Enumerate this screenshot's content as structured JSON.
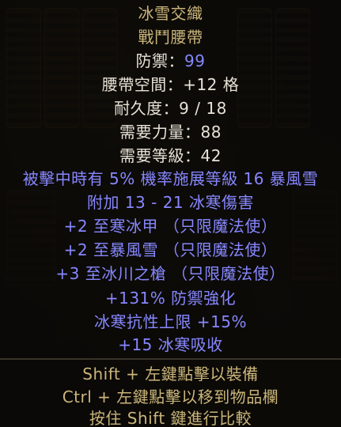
{
  "item": {
    "name": "冰雪交織",
    "type": "戰鬥腰帶",
    "defense_label": "防禦：",
    "defense_value": "99",
    "belt_slots": "腰帶空間：+12 格",
    "durability": "耐久度：9 / 18",
    "req_strength": "需要力量：88",
    "req_level": "需要等級：42"
  },
  "mods": [
    "被擊中時有 5% 機率施展等級 16 暴風雪",
    "附加 13 - 21 冰寒傷害",
    "+2 至寒冰甲 （只限魔法使）",
    "+2 至暴風雪 （只限魔法使）",
    "+3 至冰川之槍 （只限魔法使）",
    "+131% 防禦強化",
    "冰寒抗性上限 +15%",
    "+15 冰寒吸收"
  ],
  "hints": [
    "Shift + 左鍵點擊以裝備",
    "Ctrl + 左鍵點擊以移到物品欄",
    "按住 Shift 鍵進行比較"
  ],
  "colors": {
    "unique_name": "#cbb57a",
    "magic_mod": "#8787ff",
    "stat_text": "#e8e2d6"
  }
}
